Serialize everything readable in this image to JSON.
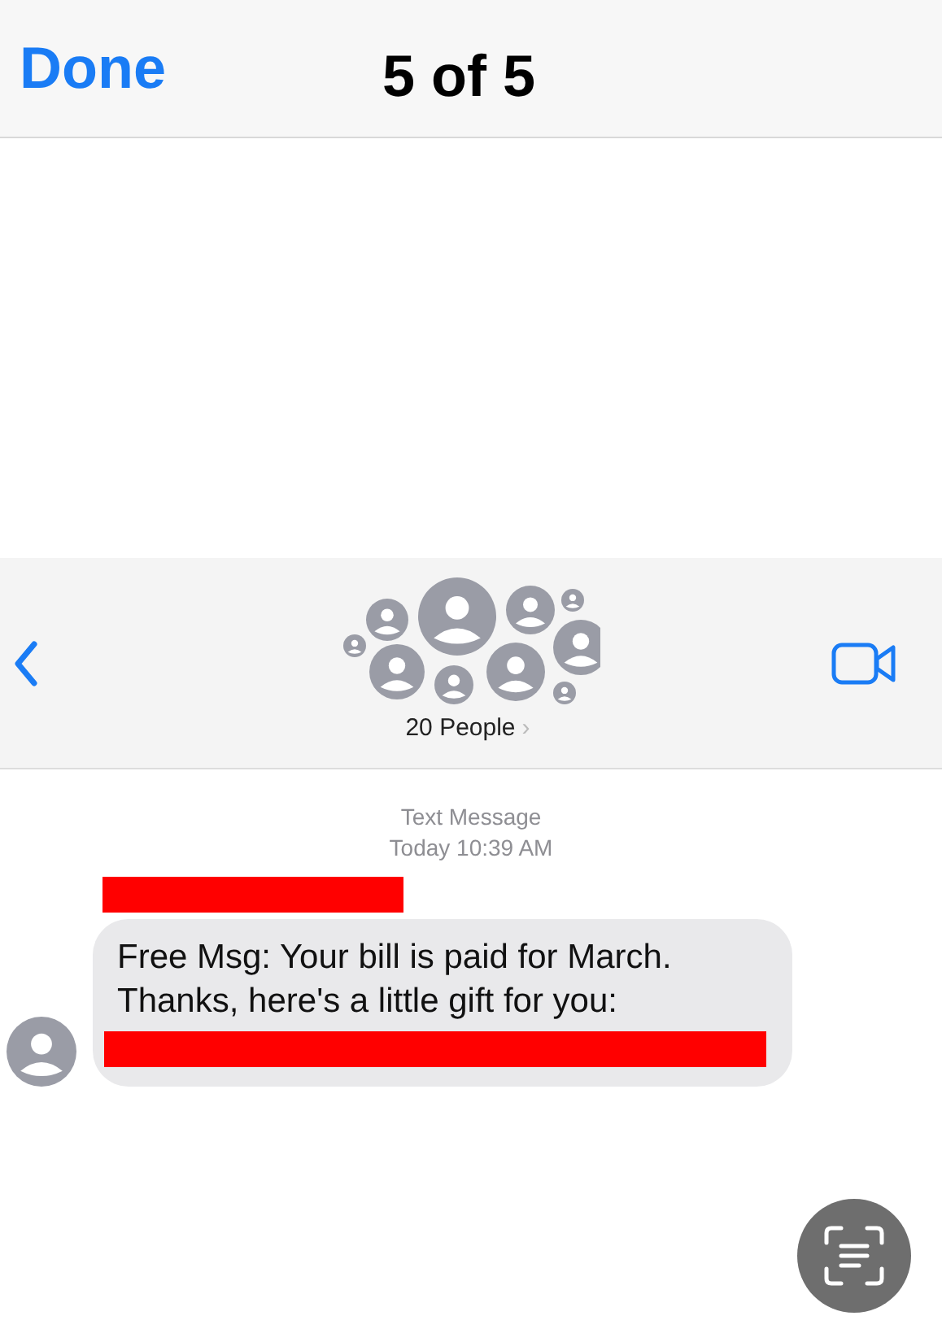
{
  "top_bar": {
    "done_label": "Done",
    "title": "5 of 5"
  },
  "conversation_header": {
    "group_name": "20 People",
    "chevron": "›"
  },
  "timestamp": {
    "service": "Text Message",
    "time": "Today 10:39 AM"
  },
  "message": {
    "text": "Free Msg: Your bill is paid for March.\nThanks, here's a little gift for you:"
  }
}
